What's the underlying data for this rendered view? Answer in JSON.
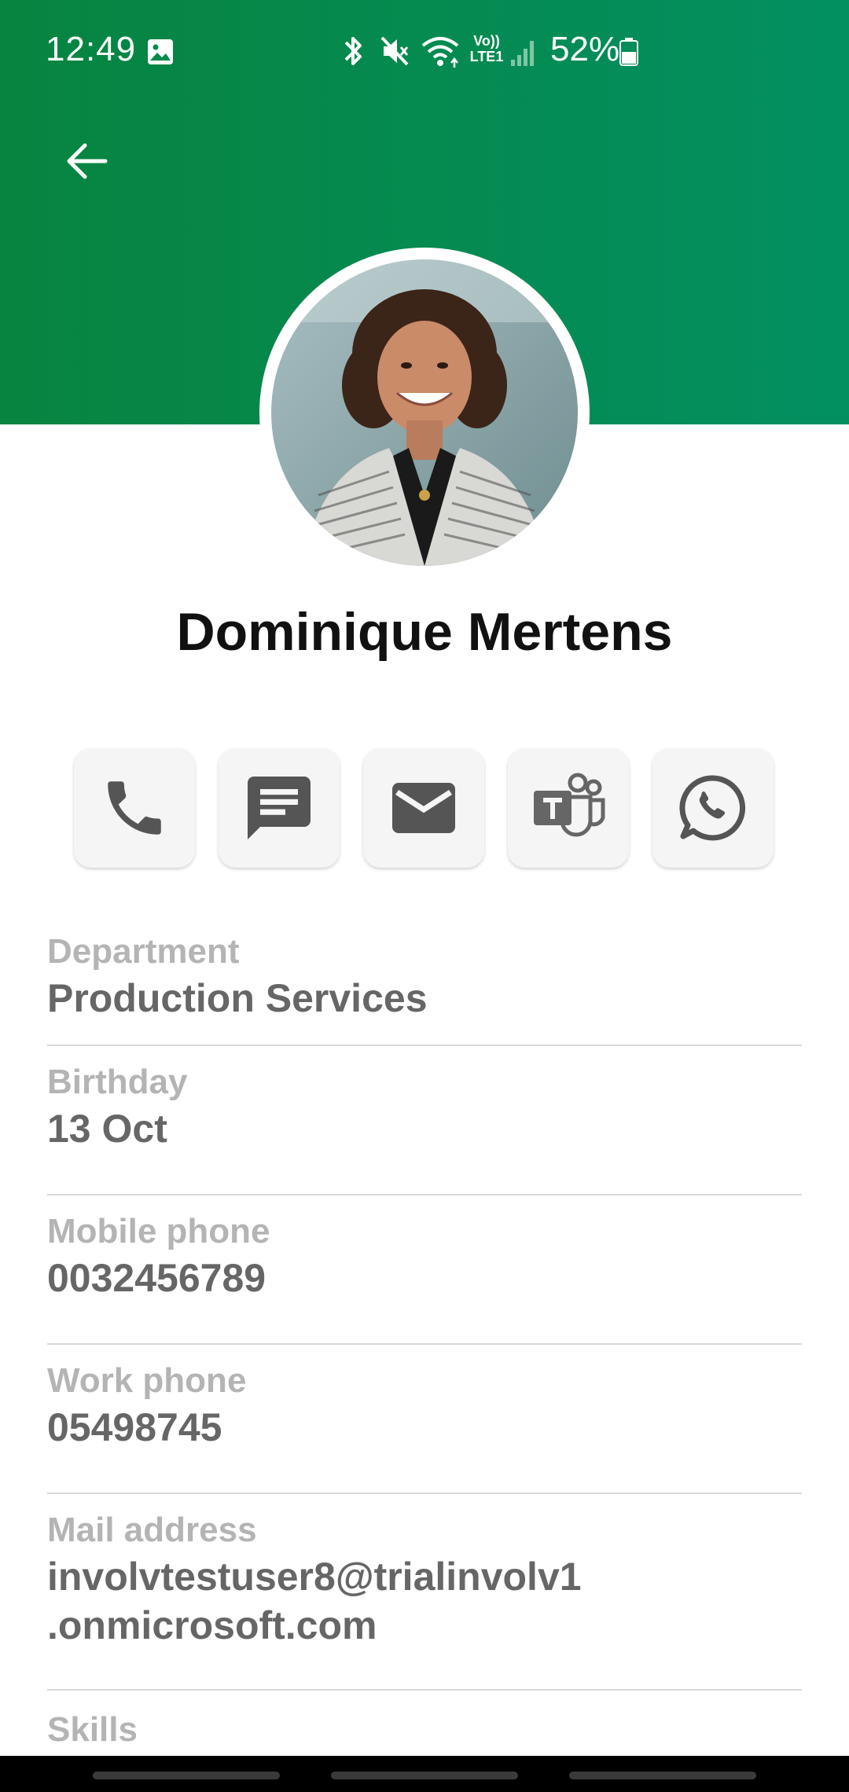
{
  "status_bar": {
    "time": "12:49",
    "battery": "52%",
    "icons": [
      "gallery-icon",
      "bluetooth-icon",
      "mute-icon",
      "wifi-icon",
      "volte-icon",
      "signal-icon",
      "battery-icon"
    ],
    "volte_label_top": "Vo))",
    "volte_label_bottom": "LTE1"
  },
  "header": {
    "colors": [
      "#07843f",
      "#039061"
    ],
    "back_icon": "back-arrow-icon"
  },
  "profile": {
    "name": "Dominique Mertens",
    "avatar": "profile-photo"
  },
  "actions": [
    {
      "name": "call",
      "icon": "phone-icon"
    },
    {
      "name": "message",
      "icon": "message-icon"
    },
    {
      "name": "email",
      "icon": "mail-icon"
    },
    {
      "name": "teams",
      "icon": "teams-icon"
    },
    {
      "name": "whatsapp",
      "icon": "whatsapp-icon"
    }
  ],
  "fields": {
    "department": {
      "label": "Department",
      "value": "Production Services"
    },
    "birthday": {
      "label": "Birthday",
      "value": "13 Oct"
    },
    "mobile": {
      "label": "Mobile phone",
      "value": "0032456789"
    },
    "work": {
      "label": "Work phone",
      "value": "05498745"
    },
    "mail": {
      "label": "Mail address",
      "value_line1": "involvtestuser8@trialinvolv1",
      "value_line2": ".onmicrosoft.com"
    },
    "skills": {
      "label": "Skills"
    }
  }
}
